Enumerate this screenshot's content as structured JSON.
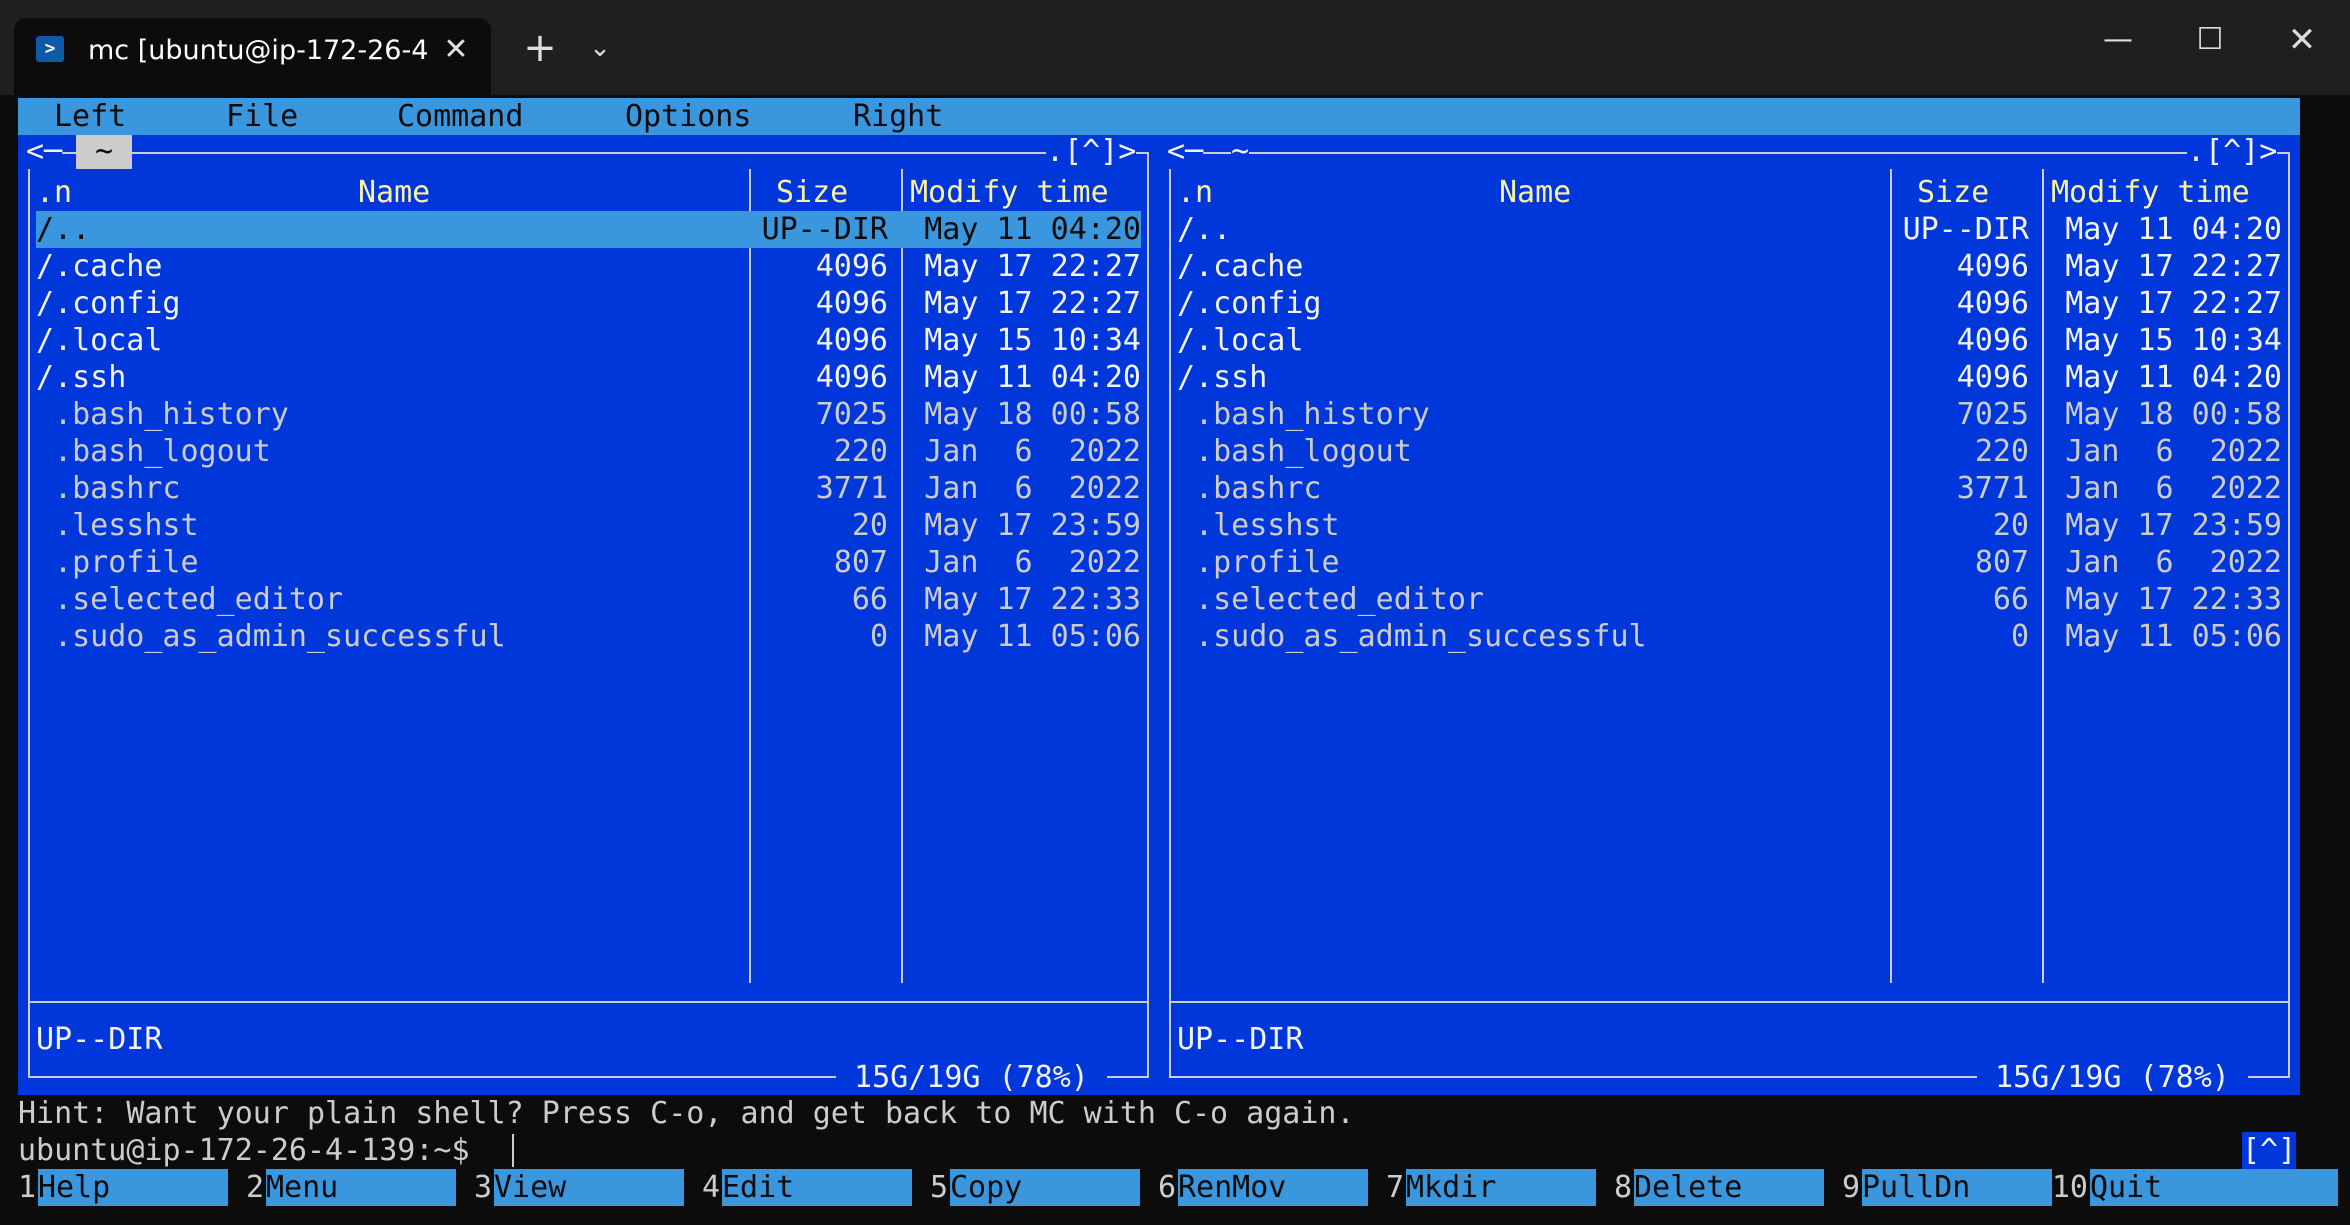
{
  "window": {
    "tab_title": "mc [ubuntu@ip-172-26-4-",
    "tab_icon": "powershell-icon",
    "close_glyph": "✕",
    "new_tab_glyph": "+",
    "dropdown_glyph": "⌄",
    "minimize_glyph": "—",
    "maximize_glyph": "☐",
    "window_close_glyph": "✕"
  },
  "menubar": {
    "items": [
      "Left",
      "File",
      "Command",
      "Options",
      "Right"
    ]
  },
  "left_panel": {
    "path_marker": "<─",
    "path": "~",
    "top_right": ".[^]>",
    "columns": {
      "name_prefix": ".n",
      "name": "Name",
      "size": "Size",
      "modify": "Modify time"
    },
    "rows": [
      {
        "name": "/..",
        "size": "UP--DIR",
        "date": "May 11 04:20",
        "type": "dir"
      },
      {
        "name": "/.cache",
        "size": "4096",
        "date": "May 17 22:27",
        "type": "dir"
      },
      {
        "name": "/.config",
        "size": "4096",
        "date": "May 17 22:27",
        "type": "dir"
      },
      {
        "name": "/.local",
        "size": "4096",
        "date": "May 15 10:34",
        "type": "dir"
      },
      {
        "name": "/.ssh",
        "size": "4096",
        "date": "May 11 04:20",
        "type": "dir"
      },
      {
        "name": " .bash_history",
        "size": "7025",
        "date": "May 18 00:58",
        "type": "file"
      },
      {
        "name": " .bash_logout",
        "size": "220",
        "date": "Jan  6  2022",
        "type": "file"
      },
      {
        "name": " .bashrc",
        "size": "3771",
        "date": "Jan  6  2022",
        "type": "file"
      },
      {
        "name": " .lesshst",
        "size": "20",
        "date": "May 17 23:59",
        "type": "file"
      },
      {
        "name": " .profile",
        "size": "807",
        "date": "Jan  6  2022",
        "type": "file"
      },
      {
        "name": " .selected_editor",
        "size": "66",
        "date": "May 17 22:33",
        "type": "file"
      },
      {
        "name": " .sudo_as_admin_successful",
        "size": "0",
        "date": "May 11 05:06",
        "type": "file"
      }
    ],
    "status": "UP--DIR",
    "disk": " 15G/19G (78%) "
  },
  "right_panel": {
    "path_marker": "<─",
    "path": "~",
    "top_right": ".[^]>",
    "columns": {
      "name_prefix": ".n",
      "name": "Name",
      "size": "Size",
      "modify": "Modify time"
    },
    "rows": [
      {
        "name": "/..",
        "size": "UP--DIR",
        "date": "May 11 04:20",
        "type": "dir"
      },
      {
        "name": "/.cache",
        "size": "4096",
        "date": "May 17 22:27",
        "type": "dir"
      },
      {
        "name": "/.config",
        "size": "4096",
        "date": "May 17 22:27",
        "type": "dir"
      },
      {
        "name": "/.local",
        "size": "4096",
        "date": "May 15 10:34",
        "type": "dir"
      },
      {
        "name": "/.ssh",
        "size": "4096",
        "date": "May 11 04:20",
        "type": "dir"
      },
      {
        "name": " .bash_history",
        "size": "7025",
        "date": "May 18 00:58",
        "type": "file"
      },
      {
        "name": " .bash_logout",
        "size": "220",
        "date": "Jan  6  2022",
        "type": "file"
      },
      {
        "name": " .bashrc",
        "size": "3771",
        "date": "Jan  6  2022",
        "type": "file"
      },
      {
        "name": " .lesshst",
        "size": "20",
        "date": "May 17 23:59",
        "type": "file"
      },
      {
        "name": " .profile",
        "size": "807",
        "date": "Jan  6  2022",
        "type": "file"
      },
      {
        "name": " .selected_editor",
        "size": "66",
        "date": "May 17 22:33",
        "type": "file"
      },
      {
        "name": " .sudo_as_admin_successful",
        "size": "0",
        "date": "May 11 05:06",
        "type": "file"
      }
    ],
    "status": "UP--DIR",
    "disk": " 15G/19G (78%) "
  },
  "hint": "Hint: Want your plain shell? Press C-o, and get back to MC with C-o again.",
  "prompt": "ubuntu@ip-172-26-4-139:~$ ",
  "cmd_indicator": "[^]",
  "function_keys": [
    {
      "num": "1",
      "label": "Help"
    },
    {
      "num": "2",
      "label": "Menu"
    },
    {
      "num": "3",
      "label": "View"
    },
    {
      "num": "4",
      "label": "Edit"
    },
    {
      "num": "5",
      "label": "Copy"
    },
    {
      "num": "6",
      "label": "RenMov"
    },
    {
      "num": "7",
      "label": "Mkdir"
    },
    {
      "num": "8",
      "label": "Delete"
    },
    {
      "num": "9",
      "label": "PullDn"
    },
    {
      "num": "10",
      "label": "Quit"
    }
  ],
  "colors": {
    "panel_bg": "#0037da",
    "menu_bg": "#3a96dd",
    "header_yellow": "#f9f1a5",
    "terminal_bg": "#0c0c0c"
  }
}
